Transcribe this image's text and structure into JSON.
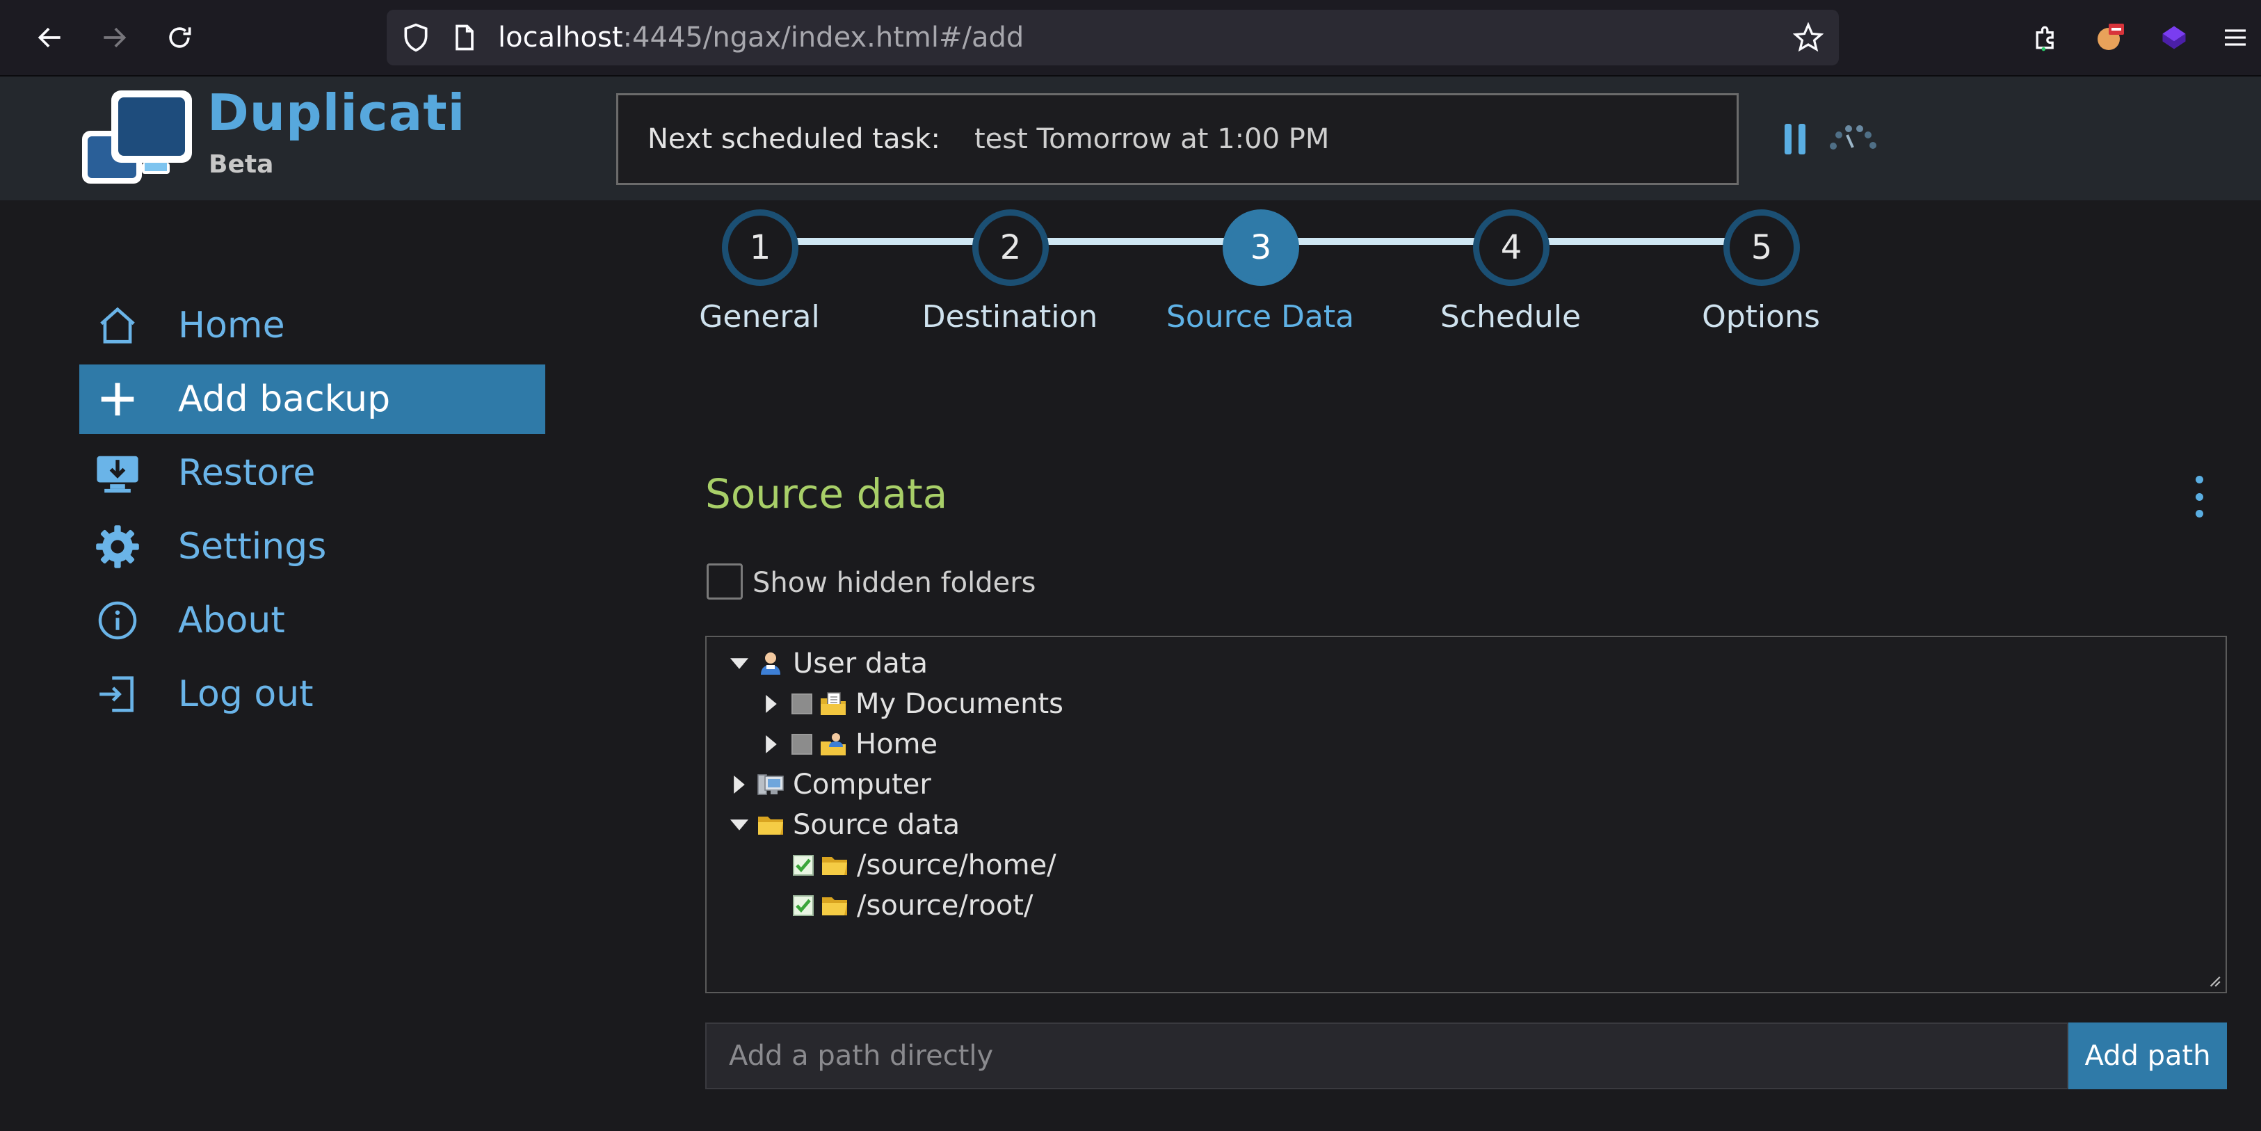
{
  "browser": {
    "url_host": "localhost",
    "url_rest": ":4445/ngax/index.html#/add"
  },
  "app": {
    "title": "Duplicati",
    "subtitle": "Beta",
    "task_label": "Next scheduled task:",
    "task_value": "test Tomorrow at 1:00 PM"
  },
  "sidebar": {
    "items": [
      {
        "label": "Home",
        "icon": "home-icon"
      },
      {
        "label": "Add backup",
        "icon": "plus-icon",
        "active": true
      },
      {
        "label": "Restore",
        "icon": "restore-icon"
      },
      {
        "label": "Settings",
        "icon": "gear-icon"
      },
      {
        "label": "About",
        "icon": "info-icon"
      },
      {
        "label": "Log out",
        "icon": "logout-icon"
      }
    ]
  },
  "steps": [
    {
      "num": "1",
      "label": "General"
    },
    {
      "num": "2",
      "label": "Destination"
    },
    {
      "num": "3",
      "label": "Source Data",
      "active": true
    },
    {
      "num": "4",
      "label": "Schedule"
    },
    {
      "num": "5",
      "label": "Options"
    }
  ],
  "source": {
    "title": "Source data",
    "show_hidden_label": "Show hidden folders",
    "tree": [
      {
        "label": "User data"
      },
      {
        "label": "My Documents"
      },
      {
        "label": "Home"
      },
      {
        "label": "Computer"
      },
      {
        "label": "Source data"
      },
      {
        "label": "/source/home/"
      },
      {
        "label": "/source/root/"
      }
    ],
    "path_placeholder": "Add a path directly",
    "add_path_label": "Add path"
  },
  "colors": {
    "accent": "#2f7aa8",
    "link": "#6ab4e8",
    "section_title": "#a8cf68",
    "background": "#1a1a1d"
  }
}
